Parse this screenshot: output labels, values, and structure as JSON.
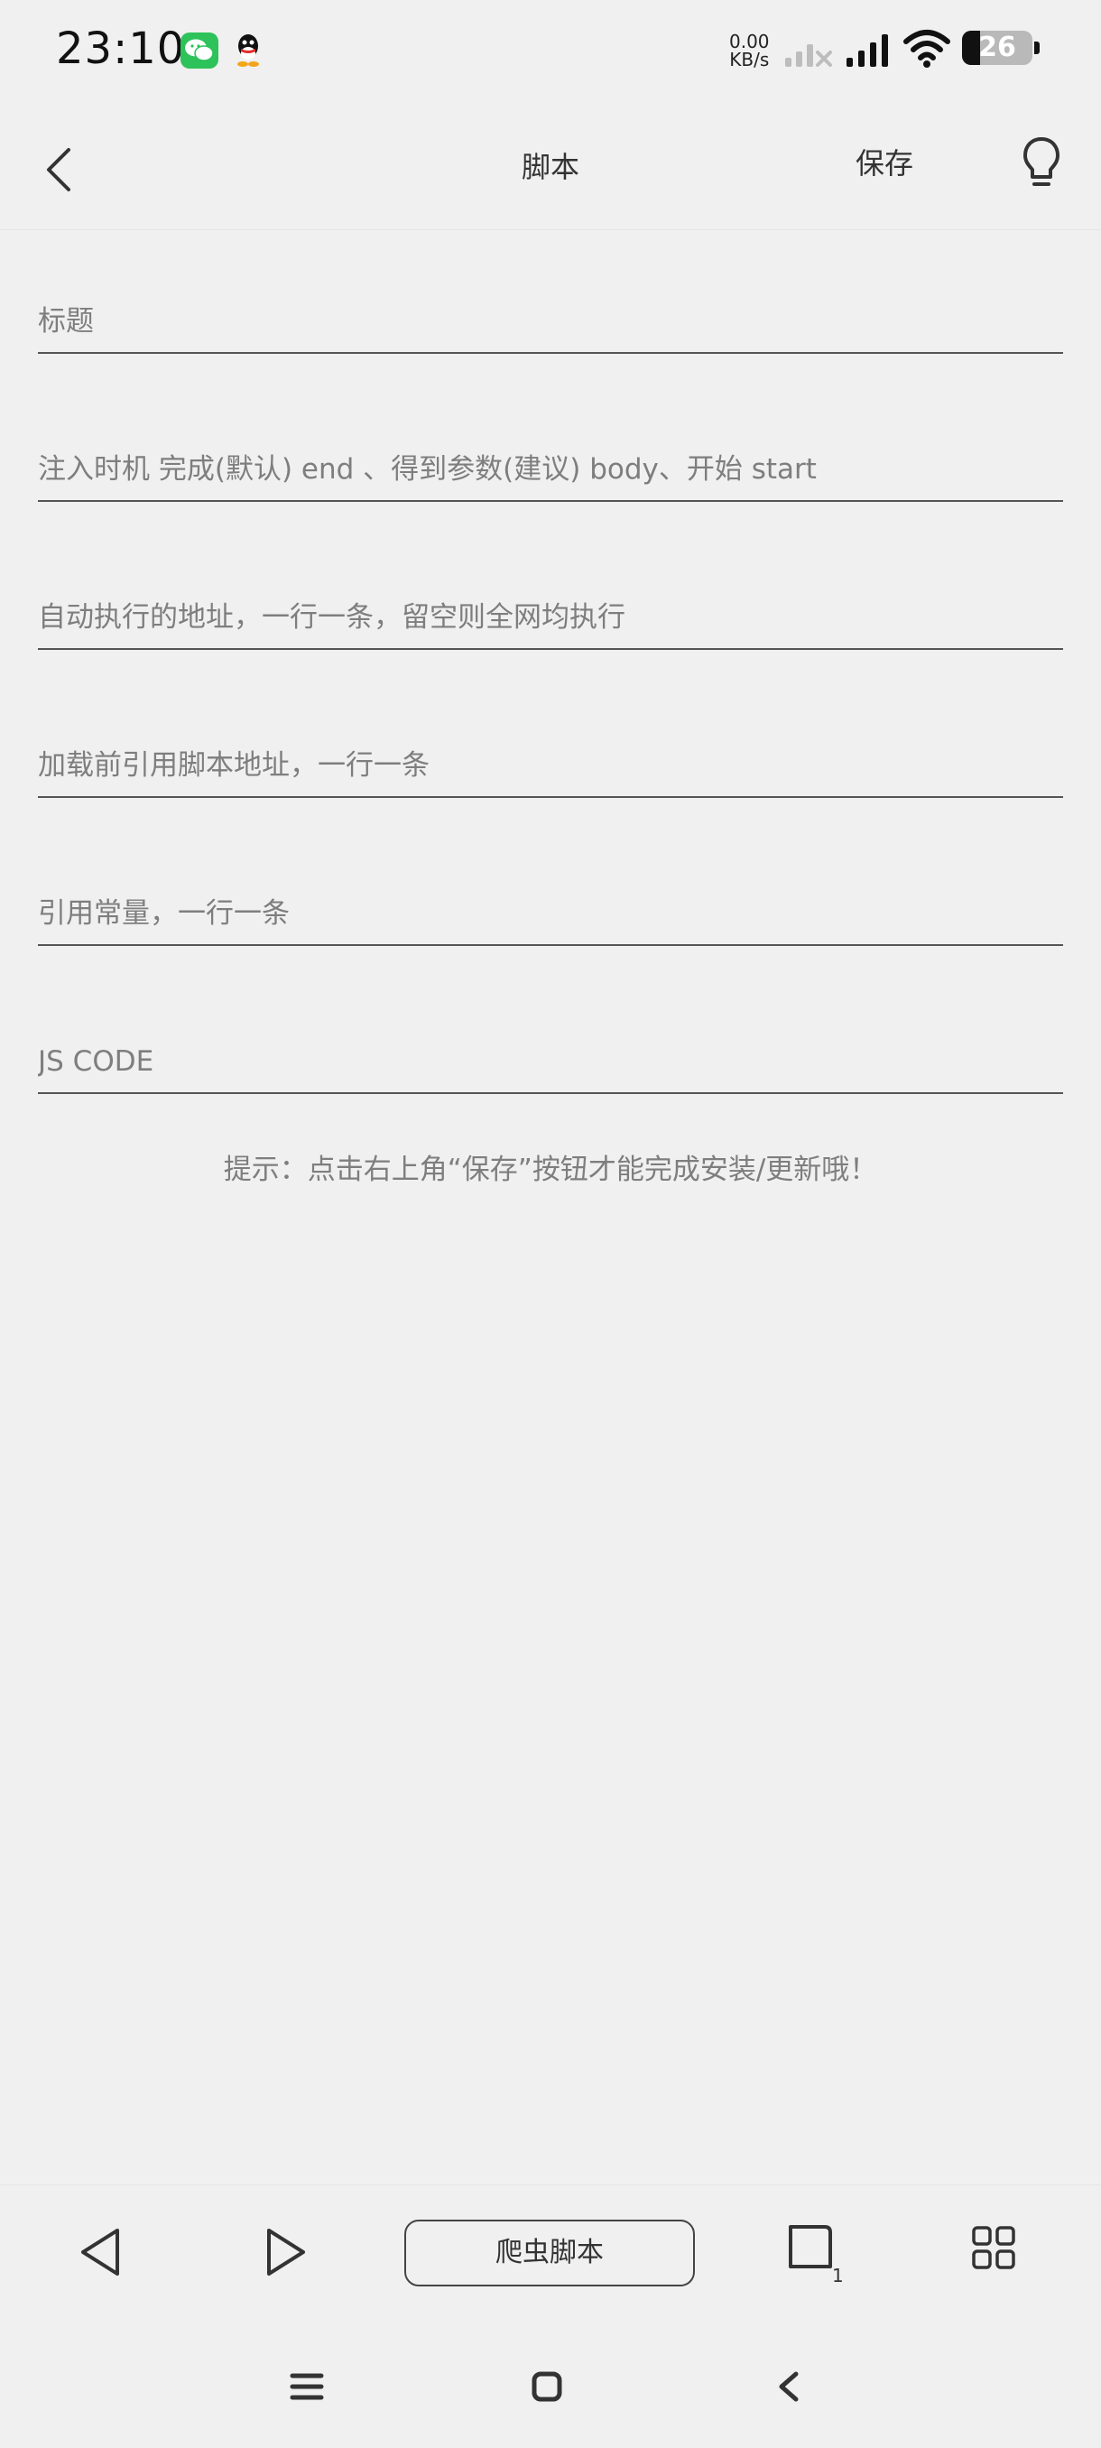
{
  "status_bar": {
    "time": "23:10",
    "net_speed_value": "0.00",
    "net_speed_unit": "KB/s",
    "battery_level": "26",
    "icons": [
      "wechat-icon",
      "qq-icon",
      "signal-icon",
      "wifi-icon",
      "battery-icon"
    ]
  },
  "toolbar": {
    "title": "脚本",
    "save_label": "保存",
    "back_icon": "chevron-left-icon",
    "tip_icon": "lightbulb-icon"
  },
  "form": {
    "title_placeholder": "标题",
    "inject_timing_placeholder": "注入时机 完成(默认) end 、得到参数(建议) body、开始 start",
    "auto_run_urls_placeholder": "自动执行的地址，一行一条，留空则全网均执行",
    "preload_scripts_placeholder": "加载前引用脚本地址，一行一条",
    "constants_placeholder": "引用常量，一行一条",
    "js_code_placeholder": "JS CODE"
  },
  "hint": "提示：点击右上角“保存”按钮才能完成安装/更新哦！",
  "bottom_bar": {
    "script_button_label": "爬虫脚本",
    "tab_count": "1"
  },
  "colors": {
    "background": "#f0f0f0",
    "text": "#333333",
    "placeholder": "#7e7e7e",
    "underline": "#555555",
    "wechat_green": "#2dc25a"
  }
}
